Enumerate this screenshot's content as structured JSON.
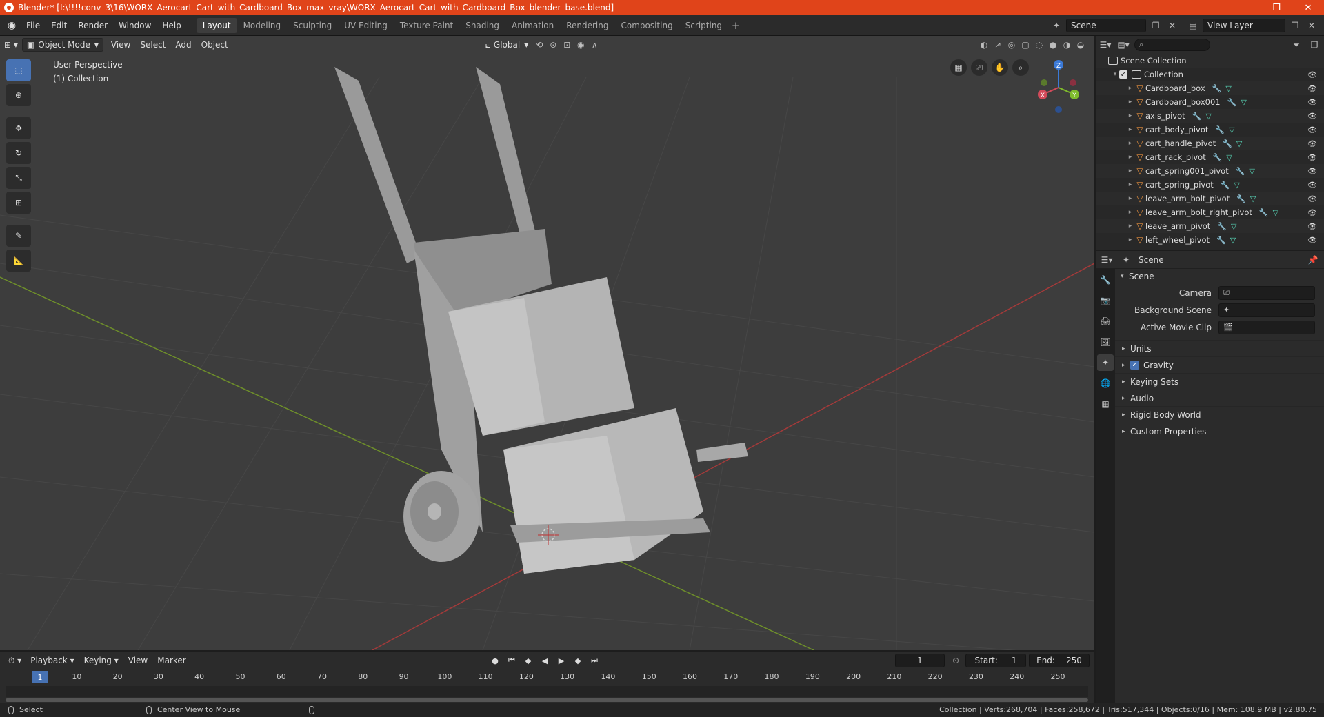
{
  "window": {
    "title": "Blender* [I:\\!!!!conv_3\\16\\WORX_Aerocart_Cart_with_Cardboard_Box_max_vray\\WORX_Aerocart_Cart_with_Cardboard_Box_blender_base.blend]",
    "min_glyph": "—",
    "max_glyph": "❐",
    "close_glyph": "✕"
  },
  "menu": {
    "items": [
      "File",
      "Edit",
      "Render",
      "Window",
      "Help"
    ]
  },
  "workspaces": {
    "tabs": [
      "Layout",
      "Modeling",
      "Sculpting",
      "UV Editing",
      "Texture Paint",
      "Shading",
      "Animation",
      "Rendering",
      "Compositing",
      "Scripting"
    ],
    "active": "Layout",
    "add_glyph": "+"
  },
  "scene_selector": {
    "value": "Scene"
  },
  "view_layer_selector": {
    "value": "View Layer"
  },
  "viewport": {
    "mode": "Object Mode",
    "menus": [
      "View",
      "Select",
      "Add",
      "Object"
    ],
    "transform_orientation": "Global",
    "info_line1": "User Perspective",
    "info_line2": "(1) Collection",
    "colors": {
      "background": "#3d3d3d",
      "grid": "#484848",
      "x_axis": "#a43a3a",
      "y_axis": "#6e8f2a"
    }
  },
  "gizmo": {
    "x": "X",
    "y": "Y",
    "z": "Z"
  },
  "outliner": {
    "root": "Scene Collection",
    "collection": "Collection",
    "objects": [
      "Cardboard_box",
      "Cardboard_box001",
      "axis_pivot",
      "cart_body_pivot",
      "cart_handle_pivot",
      "cart_rack_pivot",
      "cart_spring001_pivot",
      "cart_spring_pivot",
      "leave_arm_bolt_pivot",
      "leave_arm_bolt_right_pivot",
      "leave_arm_pivot",
      "left_wheel_pivot"
    ]
  },
  "properties": {
    "context": "Scene",
    "panel_title": "Scene",
    "fields": [
      {
        "label": "Camera",
        "value": ""
      },
      {
        "label": "Background Scene",
        "value": ""
      },
      {
        "label": "Active Movie Clip",
        "value": ""
      }
    ],
    "subpanels": [
      "Units",
      "Gravity",
      "Keying Sets",
      "Audio",
      "Rigid Body World",
      "Custom Properties"
    ]
  },
  "timeline": {
    "menus": [
      "Playback",
      "Keying",
      "View",
      "Marker"
    ],
    "current_frame": "1",
    "start_label": "Start:",
    "start": "1",
    "end_label": "End:",
    "end": "250",
    "ruler_numbers": [
      "1",
      "10",
      "20",
      "30",
      "40",
      "50",
      "60",
      "70",
      "80",
      "90",
      "100",
      "110",
      "120",
      "130",
      "140",
      "150",
      "160",
      "170",
      "180",
      "190",
      "200",
      "210",
      "220",
      "230",
      "240",
      "250"
    ]
  },
  "statusbar": {
    "left_action": "Select",
    "middle_action": "Center View to Mouse",
    "stats": "Collection | Verts:268,704 | Faces:258,672 | Tris:517,344 | Objects:0/16 | Mem: 108.9 MB | v2.80.75"
  }
}
